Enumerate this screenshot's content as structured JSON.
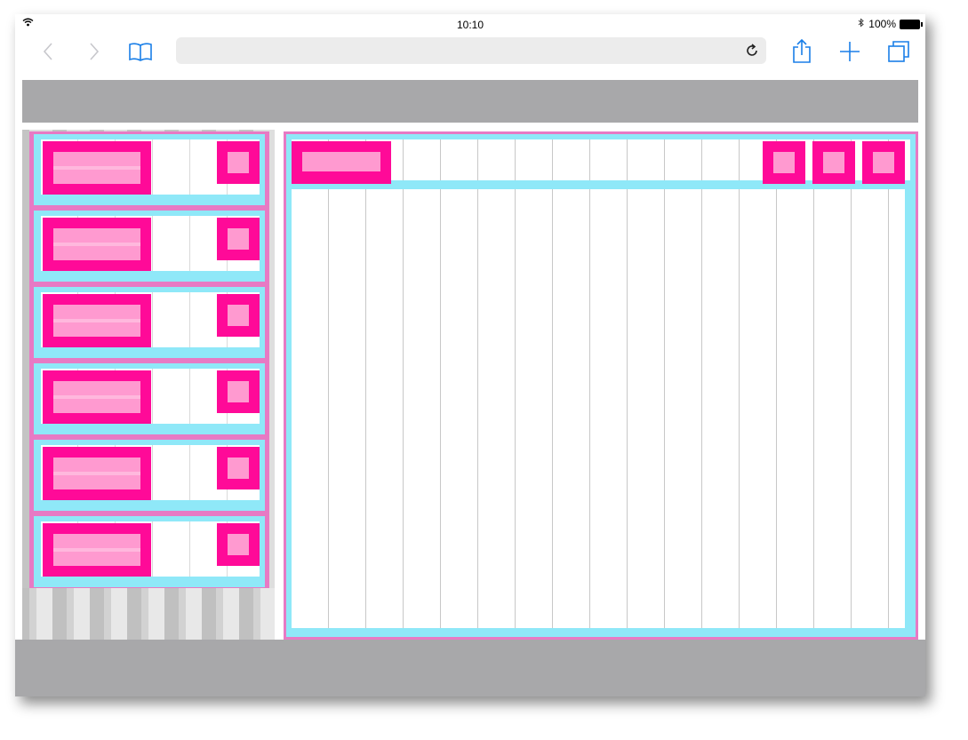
{
  "status_bar": {
    "time": "10:10",
    "battery_percent": "100%"
  },
  "toolbar": {
    "back_icon": "chevron-left-icon",
    "forward_icon": "chevron-right-icon",
    "bookmarks_icon": "book-icon",
    "url_value": "",
    "reload_icon": "reload-icon",
    "share_icon": "share-icon",
    "new_tab_icon": "plus-icon",
    "tabs_icon": "tabs-icon"
  },
  "sidebar": {
    "items": [
      {
        "label": "",
        "icon": "square-icon"
      },
      {
        "label": "",
        "icon": "square-icon"
      },
      {
        "label": "",
        "icon": "square-icon"
      },
      {
        "label": "",
        "icon": "square-icon"
      },
      {
        "label": "",
        "icon": "square-icon"
      },
      {
        "label": "",
        "icon": "square-icon"
      }
    ]
  },
  "main": {
    "header_title": "",
    "header_actions": [
      "square-icon",
      "square-icon",
      "square-icon"
    ]
  },
  "colors": {
    "accent_pink": "#ff0a98",
    "light_pink": "#ff9ad0",
    "cyan": "#8fe8f8",
    "border_pink": "#e77ac4",
    "band_gray": "#a8a8aa",
    "ios_blue": "#1a7fe8"
  }
}
